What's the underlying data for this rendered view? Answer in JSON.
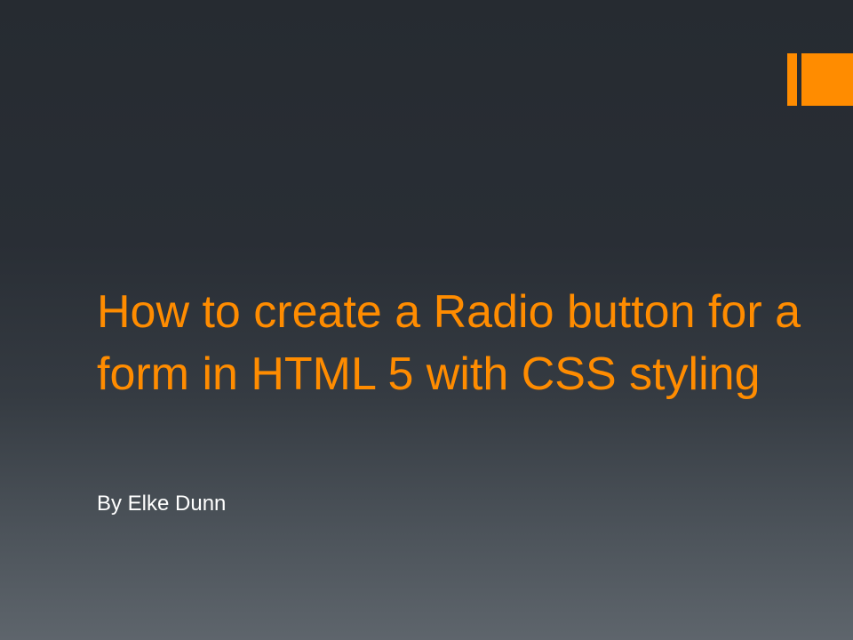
{
  "slide": {
    "title": "How to create a Radio button for a form in HTML 5 with CSS styling",
    "subtitle": "By Elke Dunn"
  },
  "colors": {
    "accent": "#ff8c00",
    "title_text": "#ff8c00",
    "subtitle_text": "#ffffff",
    "background_top": "#262b31",
    "background_bottom": "#5e656c"
  }
}
